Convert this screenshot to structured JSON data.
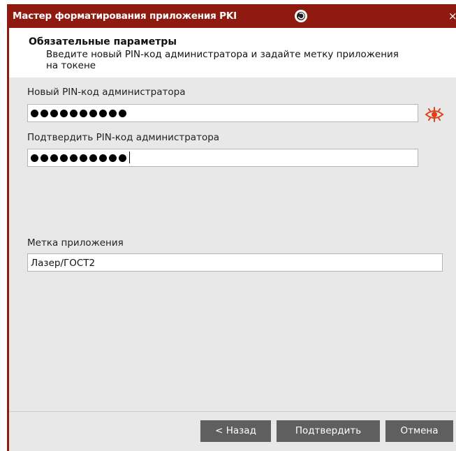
{
  "window": {
    "title": "Мастер форматирования приложения PKI",
    "close_glyph": "×",
    "icons": [
      "app-logo-icon",
      "close-icon"
    ]
  },
  "header": {
    "title": "Обязательные параметры",
    "description": "Введите новый PIN-код администратора и задайте метку приложения на токене"
  },
  "form": {
    "new_pin_label": "Новый PIN-код администратора",
    "new_pin_masked_length": 10,
    "confirm_pin_label": "Подтвердить PIN-код администратора",
    "confirm_pin_masked_length": 10,
    "show_pin_icon": "eye-icon",
    "app_label_label": "Метка приложения",
    "app_label_value": "Лазер/ГОСТ2"
  },
  "buttons": {
    "back": "< Назад",
    "confirm": "Подтвердить",
    "cancel": "Отмена"
  },
  "colors": {
    "titlebar": "#8e1a10",
    "eye_icon": "#e0401a",
    "button_bg": "#5f5f5f",
    "dialog_bg": "#e8e8e8"
  }
}
